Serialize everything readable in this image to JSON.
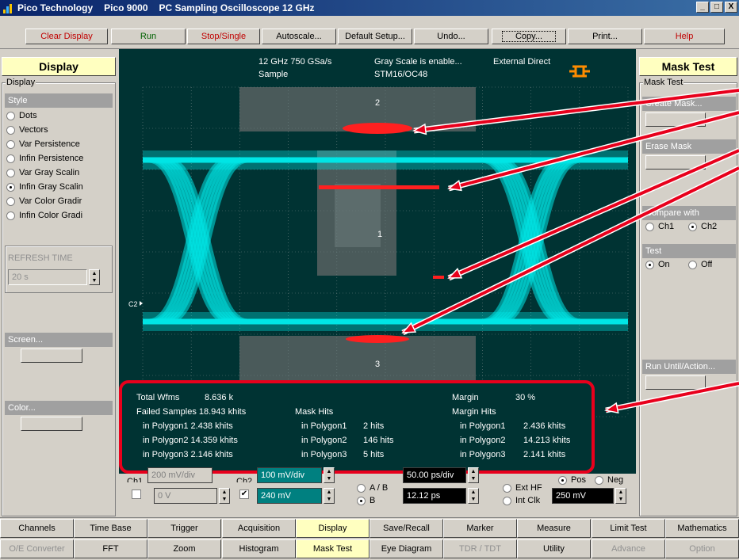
{
  "window": {
    "app": "Pico Technology",
    "product": "Pico 9000",
    "title": "PC Sampling Oscilloscope 12 GHz",
    "buttons": [
      "_",
      "□",
      "X"
    ]
  },
  "toolbar": {
    "clear": "Clear Display",
    "run": "Run",
    "stop": "Stop/Single",
    "autoscale": "Autoscale...",
    "default_setup": "Default Setup...",
    "undo": "Undo...",
    "copy": "Copy...",
    "print": "Print...",
    "help": "Help"
  },
  "left_panel": {
    "title": "Display",
    "group": "Display",
    "style_header": "Style",
    "styles": [
      {
        "label": "Dots",
        "selected": false
      },
      {
        "label": "Vectors",
        "selected": false
      },
      {
        "label": "Var Persistence",
        "selected": false
      },
      {
        "label": "Infin Persistence",
        "selected": false
      },
      {
        "label": "Var Gray Scalin",
        "selected": false
      },
      {
        "label": "Infin Gray Scalin",
        "selected": true
      },
      {
        "label": "Var Color Gradir",
        "selected": false
      },
      {
        "label": "Infin Color Gradi",
        "selected": false
      }
    ],
    "refresh_label": "REFRESH TIME",
    "refresh_value": "20 s",
    "screen": "Screen...",
    "color": "Color..."
  },
  "scope": {
    "bandwidth": "12 GHz  750 GSa/s",
    "mode": "Sample",
    "grayscale": "Gray Scale  is enable...",
    "trigger": "External Direct",
    "standard": "STM16/OC48",
    "channel_marker": "C2",
    "polygon_labels": [
      "2",
      "1",
      "3"
    ]
  },
  "stats": {
    "total_label": "Total Wfms",
    "total_value": "8.636 k",
    "failed_label": "Failed Samples 18.943 khits",
    "failed_rows": [
      "in Polygon1  2.438 khits",
      "in Polygon2  14.359 khits",
      "in Polygon3  2.146 khits"
    ],
    "mask_hits_label": "Mask Hits",
    "mask_rows": [
      "in Polygon1",
      "in Polygon2",
      "in Polygon3"
    ],
    "mask_values": [
      "2 hits",
      "146 hits",
      "5 hits"
    ],
    "margin_label": "Margin",
    "margin_value": "30 %",
    "margin_hits_label": "Margin Hits",
    "margin_rows": [
      "in Polygon1",
      "in Polygon2",
      "in Polygon3"
    ],
    "margin_values": [
      "2.436 khits",
      "14.213 khits",
      "2.141 khits"
    ]
  },
  "right_panel": {
    "title": "Mask Test",
    "group": "Mask Test",
    "create": "Create Mask...",
    "erase": "Erase Mask",
    "compare": "Compare with",
    "ch1": "Ch1",
    "ch2": "Ch2",
    "test": "Test",
    "on": "On",
    "off": "Off",
    "run_until": "Run Until/Action..."
  },
  "controls": {
    "ch1": "Ch1",
    "ch1_value": "200 mV/div",
    "ch2": "Ch2",
    "ch2_scale": "100 mV/div",
    "offset1": "0 V",
    "offset2": "240 mV",
    "ab": "A / B",
    "b": "B",
    "timebase": "50.00 ps/div",
    "delay": "12.12 ps",
    "ext_hf": "Ext HF",
    "int_clk": "Int Clk",
    "pos": "Pos",
    "neg": "Neg",
    "level": "250 mV"
  },
  "tabs": {
    "row1": [
      "Channels",
      "Time Base",
      "Trigger",
      "Acquisition",
      "Display",
      "Save/Recall",
      "Marker",
      "Measure",
      "Limit Test",
      "Mathematics"
    ],
    "row2": [
      "O/E Converter",
      "FFT",
      "Zoom",
      "Histogram",
      "Mask Test",
      "Eye Diagram",
      "TDR / TDT",
      "Utility",
      "Advance",
      "Option"
    ]
  },
  "colors": {
    "eye": "#00e6e6",
    "violation": "#ff2020",
    "highlight": "#e8001c",
    "screen": "#003333"
  }
}
